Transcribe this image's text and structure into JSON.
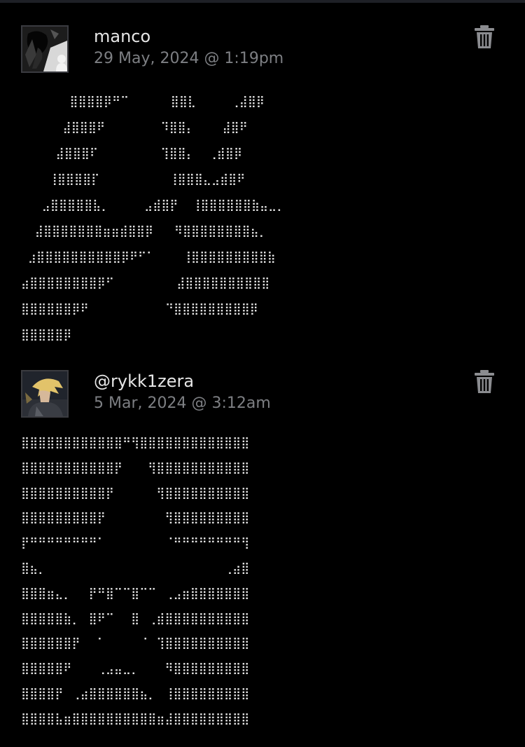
{
  "comments": [
    {
      "author": "manco",
      "timestamp": "29 May, 2024 @ 1:19pm",
      "avatar_icon": "avatar-dark-figure",
      "delete_icon": "trash-icon",
      "ascii_art": "       ⣿⣿⣿⣿⡿⠛⠉      ⣿⣿⣇     ⢀⣼⣿⡿\n      ⣼⣿⣿⣿⠟        ⠹⣿⣿⡄    ⣼⣿⠟\n     ⣼⣿⣿⣿⠏         ⢹⣿⣿⡄  ⢀⣾⣿⡿\n    ⢸⣿⣿⣿⣿⡏          ⢸⣿⣿⣿⣄⣠⣾⣿⠟\n   ⣠⣿⣿⣿⣿⣿⣧⡀     ⣠⣾⣿⡟  ⢸⣿⣿⣿⣿⣿⣿⣷⣤⣀⡀\n  ⣼⣿⣿⣿⣿⣿⣿⣿⣶⣶⣾⣿⣿⡿   ⠻⣿⣿⣿⣿⣿⣿⣿⣿⣦⡀\n ⣰⣿⣿⣿⣿⣿⣿⣿⣿⣿⣿⡿⠟⠋⠁    ⢸⣿⣿⣿⣿⣿⣿⣿⣿⣿⣷\n⣴⣿⣿⣿⣿⣿⣿⣿⣿⡿⠋         ⣼⣿⣿⣿⣿⣿⣿⣿⣿⣿⣿\n⣿⣿⣿⣿⣿⣿⡿⠟           ⠙⣿⣿⣿⣿⣿⣿⣿⣿⣿⡿\n⣿⣿⣿⣿⣿⡿"
    },
    {
      "author": "@rykk1zera",
      "timestamp": "5 Mar, 2024 @ 3:12am",
      "avatar_icon": "avatar-blond-character",
      "delete_icon": "trash-icon",
      "ascii_art": "⣿⣿⣿⣿⣿⣿⣿⣿⣿⣿⣿⣿⠛⢻⣿⣿⣿⣿⣿⣿⣿⣿⣿⣿⣿⣿⣿\n⣿⣿⣿⣿⣿⣿⣿⣿⣿⣿⣿⡟⠀⠀⠀⢻⣿⣿⣿⣿⣿⣿⣿⣿⣿⣿⣿\n⣿⣿⣿⣿⣿⣿⣿⣿⣿⣿⡟⠀⠀⠀⠀⠀⢻⣿⣿⣿⣿⣿⣿⣿⣿⣿⣿\n⣿⣿⣿⣿⣿⣿⣿⣿⣿⡟⠀⠀⠀⠀⠀⠀⠀⢻⣿⣿⣿⣿⣿⣿⣿⣿⣿\n⡟⠛⠛⠛⠛⠛⠛⠛⠛⠁⠀⠀⠀⠀⠀⠀⠀⠈⠛⠛⠛⠛⠛⠛⠛⠛⢻\n⣿⣦⡀⠀⠀⠀⠀⠀⠀⠀⠀⠀⠀⠀⠀⠀⠀⠀⠀⠀⠀⠀⠀⠀⢀⣴⣿\n⣿⣿⣿⣶⣄⡀⠀⠀⡟⠛⣿⠉⠉⣿⠉⠉⠀⢀⣠⣶⣿⣿⣿⣿⣿⣿⣿\n⣿⣿⣿⣿⣿⣷⡀⠀⣿⠟⠉⠀⠀⣿⠀⢀⣾⣿⣿⣿⣿⣿⣿⣿⣿⣿⣿\n⣿⣿⣿⣿⣿⣿⡟⠀⠀⠁⠀⠀⠀⠀⠈⠀⢹⣿⣿⣿⣿⣿⣿⣿⣿⣿⣿\n⣿⣿⣿⣿⣿⠟⠀⠀⠀⢀⣠⣤⣀⡀⠀⠀⠀⠻⣿⣿⣿⣿⣿⣿⣿⣿⣿\n⣿⣿⣿⣿⡟⠀⢀⣴⣿⣿⣿⣿⣿⣿⣦⡀⠀⢸⣿⣿⣿⣿⣿⣿⣿⣿⣿\n⣿⣿⣿⣿⣧⣶⣿⣿⣿⣿⣿⣿⣿⣿⣿⣿⣶⣼⣿⣿⣿⣿⣿⣿⣿⣿⣿"
    }
  ]
}
